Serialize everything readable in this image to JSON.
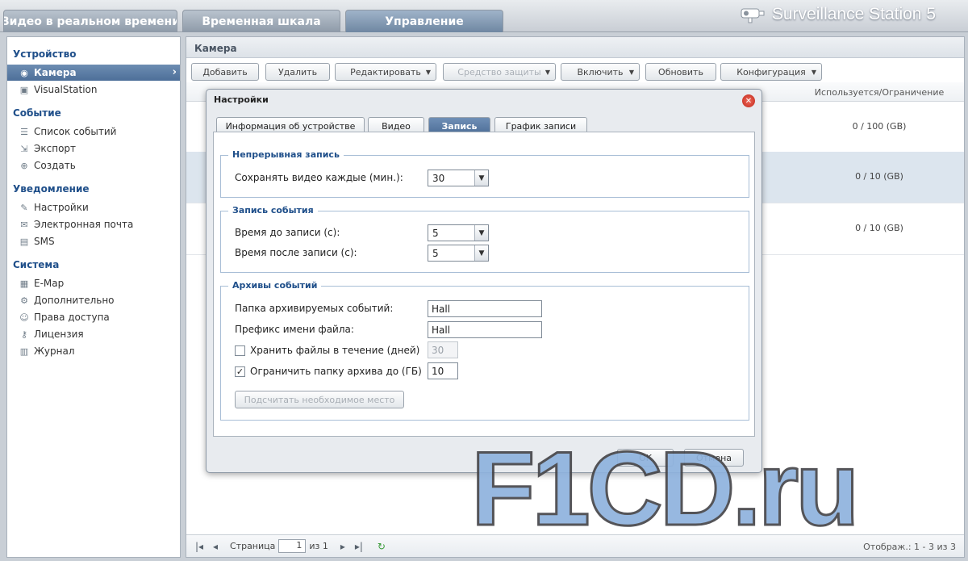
{
  "top_tabs": [
    "Видео в реальном времени",
    "Временная шкала",
    "Управление"
  ],
  "brand": "Surveillance Station 5",
  "sidebar": {
    "sections": [
      {
        "title": "Устройство",
        "items": [
          {
            "label": "Камера",
            "icon": "camera-icon"
          },
          {
            "label": "VisualStation",
            "icon": "visualstation-icon"
          }
        ]
      },
      {
        "title": "Событие",
        "items": [
          {
            "label": "Список событий",
            "icon": "list-icon"
          },
          {
            "label": "Экспорт",
            "icon": "export-icon"
          },
          {
            "label": "Создать",
            "icon": "create-icon"
          }
        ]
      },
      {
        "title": "Уведомление",
        "items": [
          {
            "label": "Настройки",
            "icon": "wrench-icon"
          },
          {
            "label": "Электронная почта",
            "icon": "mail-icon"
          },
          {
            "label": "SMS",
            "icon": "sms-icon"
          }
        ]
      },
      {
        "title": "Система",
        "items": [
          {
            "label": "E-Map",
            "icon": "map-icon"
          },
          {
            "label": "Дополнительно",
            "icon": "gear-icon"
          },
          {
            "label": "Права доступа",
            "icon": "users-icon"
          },
          {
            "label": "Лицензия",
            "icon": "key-icon"
          },
          {
            "label": "Журнал",
            "icon": "book-icon"
          }
        ]
      }
    ]
  },
  "main": {
    "title": "Камера",
    "toolbar": [
      "Добавить",
      "Удалить",
      "Редактировать",
      "Средство защиты",
      "Включить",
      "Обновить",
      "Конфигурация"
    ],
    "column_usage": "Используется/Ограничение",
    "rows": [
      "0 / 100 (GB)",
      "0 / 10 (GB)",
      "0 / 10 (GB)"
    ],
    "pager": {
      "page_label": "Страница",
      "page": "1",
      "of": "из 1",
      "info": "Отображ.: 1 - 3 из 3"
    }
  },
  "dialog": {
    "title": "Настройки",
    "tabs": [
      "Информация об устройстве",
      "Видео",
      "Запись",
      "График записи"
    ],
    "continuous": {
      "legend": "Непрерывная запись",
      "label": "Сохранять видео каждые (мин.):",
      "value": "30"
    },
    "event": {
      "legend": "Запись события",
      "pre_label": "Время до записи (с):",
      "pre_value": "5",
      "post_label": "Время после записи (с):",
      "post_value": "5"
    },
    "archive": {
      "legend": "Архивы событий",
      "folder_label": "Папка архивируемых событий:",
      "folder_value": "Hall",
      "prefix_label": "Префикс имени файла:",
      "prefix_value": "Hall",
      "keep_label": "Хранить файлы в течение (дней)",
      "keep_checked": false,
      "keep_value": "30",
      "limit_label": "Ограничить папку архива до (ГБ)",
      "limit_checked": true,
      "limit_value": "10",
      "calc_button": "Подсчитать необходимое место"
    },
    "ok": "OK",
    "cancel": "Отмена"
  },
  "watermark": "F1CD.ru"
}
